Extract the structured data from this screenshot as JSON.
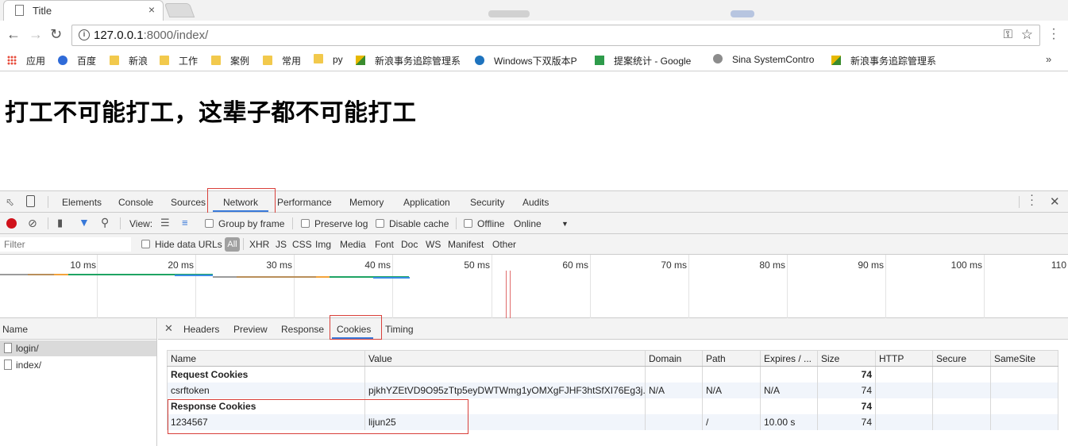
{
  "browser": {
    "tab_title": "Title",
    "tab_close": "×",
    "url_host": "127.0.0.1",
    "url_rest": ":8000/index/",
    "bookmarks": [
      {
        "label": "应用",
        "icon": "apps-grid-icon"
      },
      {
        "label": "百度",
        "icon": "baidu-paw-icon"
      },
      {
        "label": "新浪",
        "icon": "folder-icon"
      },
      {
        "label": "工作",
        "icon": "folder-icon"
      },
      {
        "label": "案例",
        "icon": "folder-icon"
      },
      {
        "label": "常用",
        "icon": "folder-icon"
      },
      {
        "label": "py",
        "icon": "folder-icon"
      },
      {
        "label": "新浪事务追踪管理系",
        "icon": "sina-tracker-icon"
      },
      {
        "label": "Windows下双版本P",
        "icon": "video-play-icon"
      },
      {
        "label": "提案统计 - Google",
        "icon": "google-sheets-icon"
      },
      {
        "label": "Sina SystemContro",
        "icon": "globe-icon"
      },
      {
        "label": "新浪事务追踪管理系",
        "icon": "sina-tracker-icon"
      }
    ],
    "bookmarks_more": "»"
  },
  "page": {
    "heading": "打工不可能打工，这辈子都不可能打工"
  },
  "devtools": {
    "tabs": [
      "Elements",
      "Console",
      "Sources",
      "Network",
      "Performance",
      "Memory",
      "Application",
      "Security",
      "Audits"
    ],
    "active_tab": "Network",
    "controls": {
      "view_label": "View:",
      "group_by_frame": "Group by frame",
      "preserve_log": "Preserve log",
      "disable_cache": "Disable cache",
      "offline": "Offline",
      "throttle": "Online"
    },
    "filter": {
      "placeholder": "Filter",
      "hide_data_urls": "Hide data URLs",
      "all": "All",
      "types": [
        "XHR",
        "JS",
        "CSS",
        "Img",
        "Media",
        "Font",
        "Doc",
        "WS",
        "Manifest",
        "Other"
      ]
    },
    "timeline_ticks": [
      "10 ms",
      "20 ms",
      "30 ms",
      "40 ms",
      "50 ms",
      "60 ms",
      "70 ms",
      "80 ms",
      "90 ms",
      "100 ms",
      "110"
    ],
    "requests": {
      "header": "Name",
      "items": [
        {
          "name": "login/",
          "selected": true
        },
        {
          "name": "index/",
          "selected": false
        }
      ]
    },
    "detail_tabs": [
      "Headers",
      "Preview",
      "Response",
      "Cookies",
      "Timing"
    ],
    "active_detail_tab": "Cookies",
    "cookies": {
      "columns": [
        "Name",
        "Value",
        "Domain",
        "Path",
        "Expires / ...",
        "Size",
        "HTTP",
        "Secure",
        "SameSite"
      ],
      "rows": [
        {
          "kind": "group",
          "cells": [
            "Request Cookies",
            "",
            "",
            "",
            "",
            "74",
            "",
            "",
            ""
          ]
        },
        {
          "kind": "row",
          "cells": [
            "csrftoken",
            "pjkhYZEtVD9O95zTtp5eyDWTWmg1yOMXgFJHF3htSfXI76Eg3j...",
            "N/A",
            "N/A",
            "N/A",
            "74",
            "",
            "",
            ""
          ]
        },
        {
          "kind": "group",
          "cells": [
            "Response Cookies",
            "",
            "",
            "",
            "",
            "74",
            "",
            "",
            ""
          ]
        },
        {
          "kind": "row",
          "cells": [
            "1234567",
            "lijun25",
            "",
            "/",
            "10.00 s",
            "74",
            "",
            "",
            ""
          ]
        }
      ]
    }
  }
}
